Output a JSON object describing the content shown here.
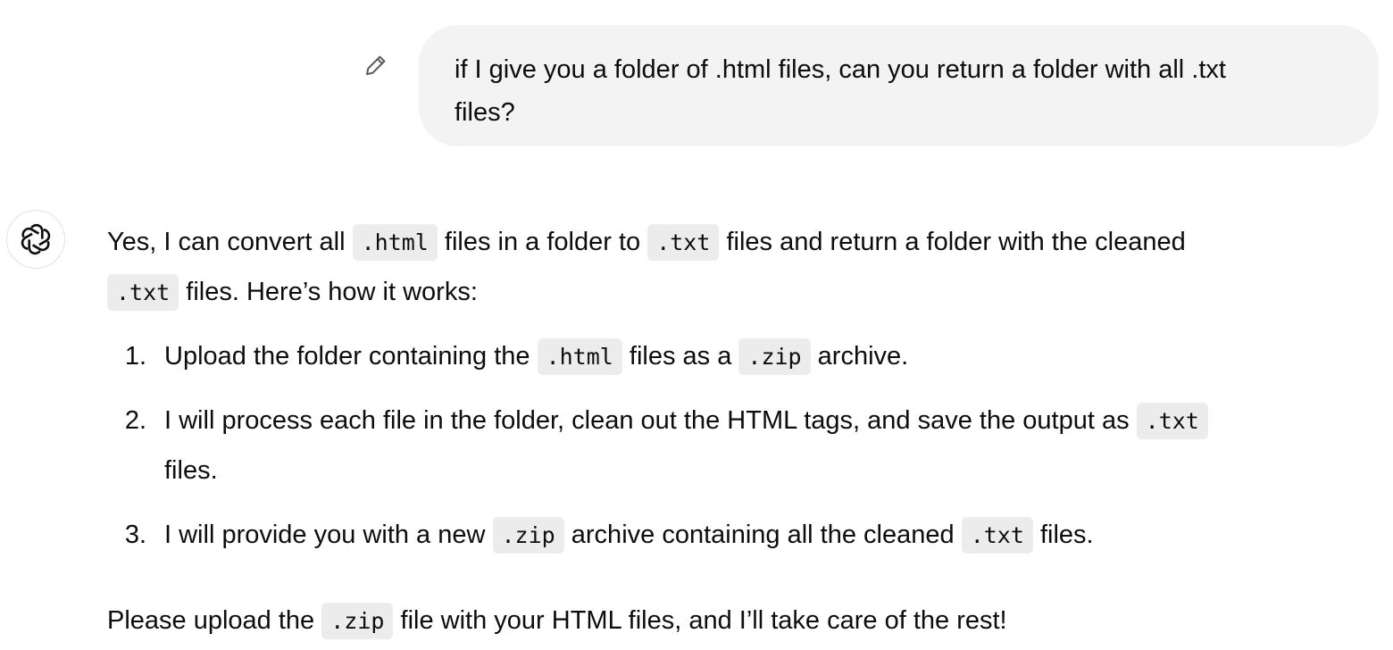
{
  "user_message": {
    "line1": "if I give you a folder of .html files, can you return a folder with all .txt",
    "line2": "files?"
  },
  "assistant": {
    "avatar_icon": "openai-logo-icon",
    "intro": {
      "t1": "Yes, I can convert all ",
      "c1": ".html",
      "t2": " files in a folder to ",
      "c2": ".txt",
      "t3": " files and return a folder with the cleaned",
      "c3": ".txt",
      "t4": " files. Here’s how it works:"
    },
    "steps": [
      {
        "num": "1.",
        "t1": "Upload the folder containing the ",
        "c1": ".html",
        "t2": " files as a ",
        "c2": ".zip",
        "t3": " archive."
      },
      {
        "num": "2.",
        "t1": "I will process each file in the folder, clean out the HTML tags, and save the output as ",
        "c1": ".txt",
        "t2": "files."
      },
      {
        "num": "3.",
        "t1": "I will provide you with a new ",
        "c1": ".zip",
        "t2": " archive containing all the cleaned ",
        "c2": ".txt",
        "t3": " files."
      }
    ],
    "closing": {
      "t1": "Please upload the ",
      "c1": ".zip",
      "t2": " file with your HTML files, and I’ll take care of the rest!"
    }
  }
}
